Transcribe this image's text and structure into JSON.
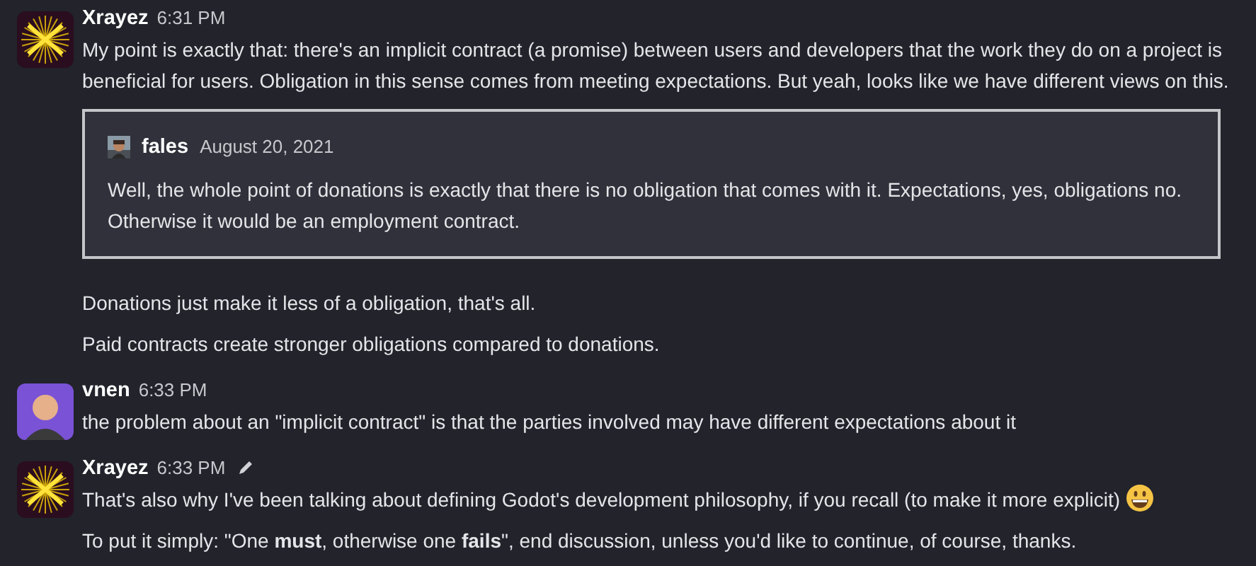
{
  "messages": [
    {
      "author": "Xrayez",
      "time": "6:31 PM",
      "edited": false,
      "avatar": {
        "kind": "burst"
      },
      "blocks": [
        {
          "kind": "text",
          "text": "My point is exactly that: there's an implicit contract (a promise) between users and developers that the work they do on a project is beneficial for users. Obligation in this sense comes from meeting expectations. But yeah, looks like we have different views on this."
        },
        {
          "kind": "quote",
          "author": "fales",
          "date": "August 20, 2021",
          "text": "Well, the whole point of donations is exactly that there is no obligation that comes with it. Expectations, yes, obligations no. Otherwise it would be an employment contract."
        },
        {
          "kind": "text",
          "text": "Donations just make it less of a obligation, that's all."
        },
        {
          "kind": "text",
          "text": "Paid contracts create stronger obligations compared to donations."
        }
      ]
    },
    {
      "author": "vnen",
      "time": "6:33 PM",
      "edited": false,
      "avatar": {
        "kind": "figure"
      },
      "blocks": [
        {
          "kind": "text",
          "text": "the problem about an \"implicit contract\" is that the parties involved may have different expectations about it"
        }
      ]
    },
    {
      "author": "Xrayez",
      "time": "6:33 PM",
      "edited": true,
      "avatar": {
        "kind": "burst"
      },
      "blocks": [
        {
          "kind": "text",
          "text": "That's also why I've been talking about defining Godot's development philosophy, if you recall (to make it more explicit)",
          "emoji": true
        },
        {
          "kind": "text",
          "text": "To put it simply: \"One **must**, otherwise one **fails**\", end discussion, unless you'd like to continue, of course, thanks."
        }
      ]
    }
  ]
}
